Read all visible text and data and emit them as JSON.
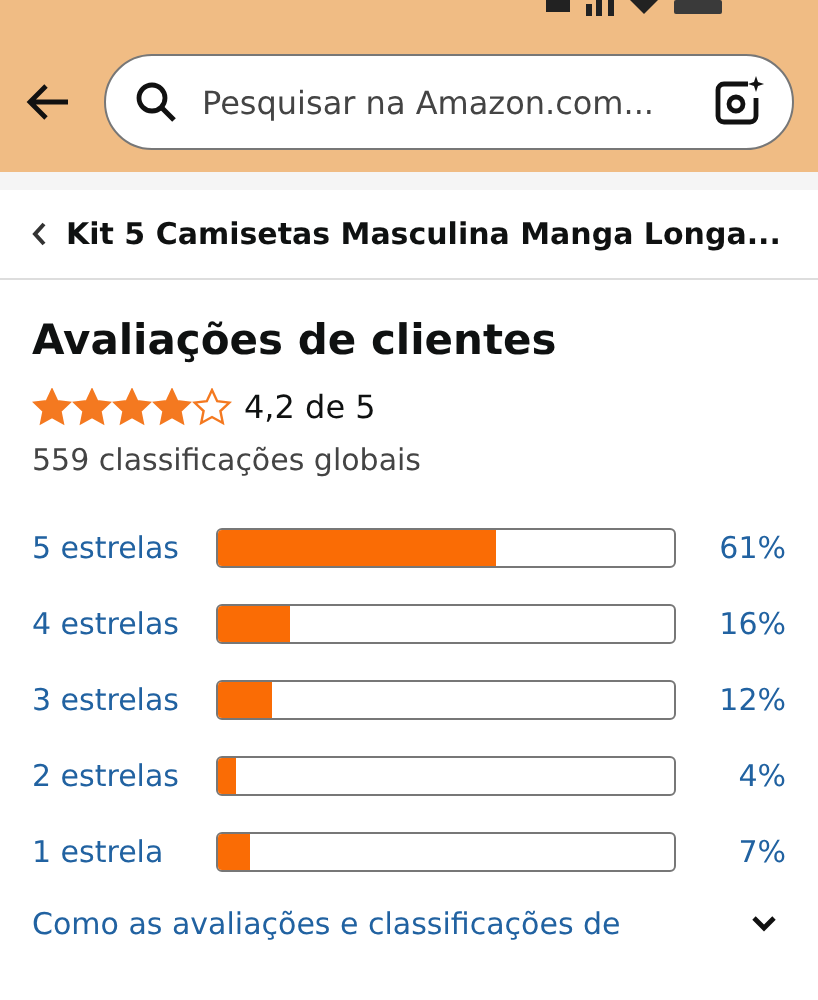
{
  "header": {
    "search": {
      "placeholder": "Pesquisar na Amazon.com..."
    }
  },
  "breadcrumb": {
    "title": "Kit 5 Camisetas Masculina Manga Longa..."
  },
  "reviews": {
    "heading": "Avaliações de clientes",
    "stars": 4,
    "rating": "4,2 de 5",
    "total": "559 classificações globais",
    "histogram": [
      {
        "label": "5 estrelas",
        "level": 0.61,
        "percent": "61%"
      },
      {
        "label": "4 estrelas",
        "level": 0.16,
        "percent": "16%"
      },
      {
        "label": "3 estrelas",
        "level": 0.12,
        "percent": "12%"
      },
      {
        "label": "2 estrelas",
        "level": 0.04,
        "percent": "4%"
      },
      {
        "label": "1 estrela",
        "level": 0.07,
        "percent": "7%"
      }
    ],
    "explainer": {
      "label": "Como as avaliações e classificações de",
      "expanded": false
    }
  }
}
